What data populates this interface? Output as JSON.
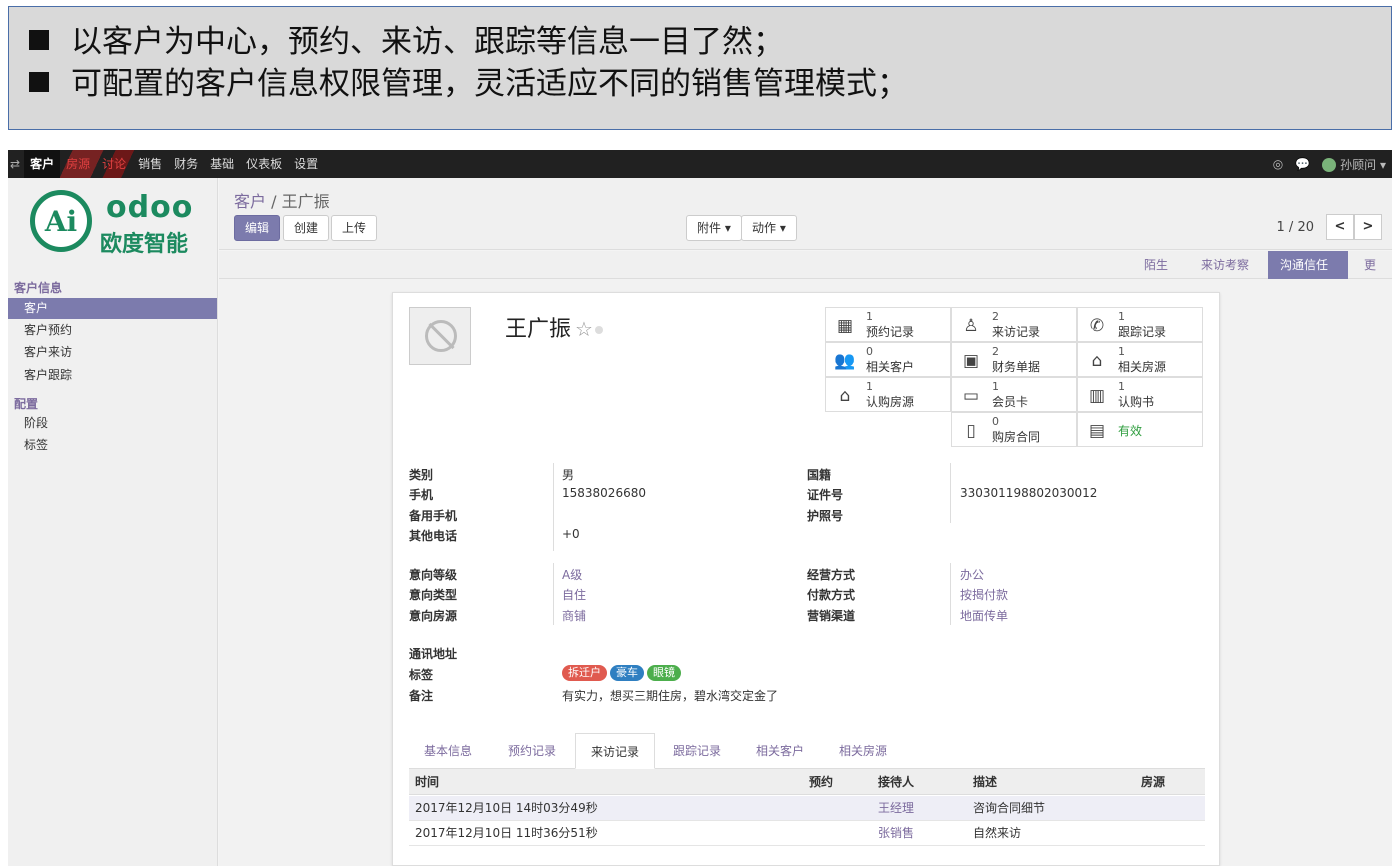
{
  "banner": {
    "line1": "以客户为中心，预约、来访、跟踪等信息一目了然；",
    "line2": "可配置的客户信息权限管理，灵活适应不同的销售管理模式；"
  },
  "topnav": {
    "menus": [
      "客户",
      "房源",
      "讨论",
      "销售",
      "财务",
      "基础",
      "仪表板",
      "设置"
    ],
    "user": "孙顾问"
  },
  "logo": {
    "text1": "odoo",
    "text2": "欧度智能",
    "mark": "Ai"
  },
  "sidebar": {
    "section1": "客户信息",
    "items1": [
      "客户",
      "客户预约",
      "客户来访",
      "客户跟踪"
    ],
    "section2": "配置",
    "items2": [
      "阶段",
      "标签"
    ]
  },
  "control": {
    "breadcrumb_parent": "客户",
    "breadcrumb_sep": "/",
    "breadcrumb_current": "王广振",
    "edit": "编辑",
    "create": "创建",
    "upload": "上传",
    "attachment": "附件 ▾",
    "action": "动作 ▾",
    "pager": "1 / 20",
    "prev": "<",
    "next": ">"
  },
  "stages": [
    "陌生",
    "来访考察",
    "沟通信任",
    "更多"
  ],
  "record": {
    "name": "王广振",
    "smart_buttons": [
      {
        "count": "1",
        "label": "预约记录",
        "icon": "calendar-icon"
      },
      {
        "count": "2",
        "label": "来访记录",
        "icon": "person-icon"
      },
      {
        "count": "1",
        "label": "跟踪记录",
        "icon": "phone-icon"
      },
      {
        "count": "0",
        "label": "相关客户",
        "icon": "users-icon"
      },
      {
        "count": "2",
        "label": "财务单据",
        "icon": "money-icon"
      },
      {
        "count": "1",
        "label": "相关房源",
        "icon": "home-icon"
      },
      {
        "count": "1",
        "label": "认购房源",
        "icon": "home-icon"
      },
      {
        "count": "1",
        "label": "会员卡",
        "icon": "card-icon"
      },
      {
        "count": "1",
        "label": "认购书",
        "icon": "book-icon"
      },
      {
        "count": "0",
        "label": "购房合同",
        "icon": "file-icon"
      },
      {
        "count": "",
        "label": "有效",
        "icon": "archive-icon"
      }
    ],
    "fields_left": [
      {
        "label": "类别",
        "value": "男"
      },
      {
        "label": "手机",
        "value": "15838026680"
      },
      {
        "label": "备用手机",
        "value": ""
      },
      {
        "label": "其他电话",
        "value": "+0"
      }
    ],
    "fields_right": [
      {
        "label": "国籍",
        "value": ""
      },
      {
        "label": "证件号",
        "value": "330301198802030012"
      },
      {
        "label": "护照号",
        "value": ""
      }
    ],
    "fields_left2": [
      {
        "label": "意向等级",
        "value": "A级"
      },
      {
        "label": "意向类型",
        "value": "自住"
      },
      {
        "label": "意向房源",
        "value": "商铺"
      }
    ],
    "fields_right2": [
      {
        "label": "经营方式",
        "value": "办公"
      },
      {
        "label": "付款方式",
        "value": "按揭付款"
      },
      {
        "label": "营销渠道",
        "value": "地面传单"
      }
    ],
    "address_label": "通讯地址",
    "tags_label": "标签",
    "tags": [
      {
        "text": "拆迁户",
        "color": "#e05a4f"
      },
      {
        "text": "豪车",
        "color": "#2f7fc1"
      },
      {
        "text": "眼镜",
        "color": "#4cae4c"
      }
    ],
    "note_label": "备注",
    "note": "有实力，想买三期住房，碧水湾交定金了"
  },
  "tabs": [
    "基本信息",
    "预约记录",
    "来访记录",
    "跟踪记录",
    "相关客户",
    "相关房源"
  ],
  "table": {
    "headers": [
      "时间",
      "预约",
      "接待人",
      "描述",
      "房源"
    ],
    "rows": [
      [
        "2017年12月10日 14时03分49秒",
        "",
        "王经理",
        "咨询合同细节",
        ""
      ],
      [
        "2017年12月10日 11时36分51秒",
        "",
        "张销售",
        "自然来访",
        ""
      ]
    ]
  }
}
